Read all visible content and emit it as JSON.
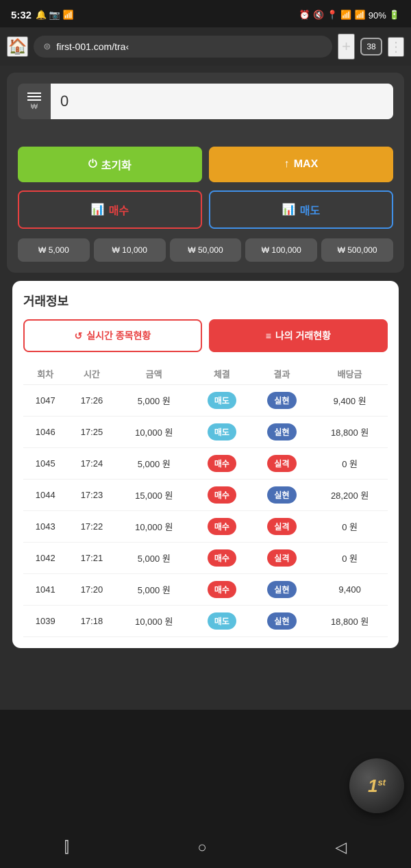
{
  "statusBar": {
    "time": "5:32",
    "battery": "90%",
    "batteryIcon": "🔋"
  },
  "browserBar": {
    "url": "first-001.com/tra‹",
    "tabCount": "38"
  },
  "trading": {
    "amountValue": "0",
    "amountPlaceholder": "0",
    "resetLabel": "초기화",
    "maxLabel": "MAX",
    "buyLabel": "매수",
    "sellLabel": "매도",
    "quickAmounts": [
      "₩ 5,000",
      "₩ 10,000",
      "₩ 50,000",
      "₩ 100,000",
      "₩ 500,000"
    ]
  },
  "tradingInfo": {
    "sectionTitle": "거래정보",
    "tabRealtime": "실시간 종목현황",
    "tabMyTrades": "나의 거래현황",
    "tableHeaders": [
      "회차",
      "시간",
      "금액",
      "체결",
      "결과",
      "배당금"
    ],
    "rows": [
      {
        "round": "1047",
        "time": "17:26",
        "amount": "5,000 원",
        "type": "매도",
        "typeClass": "sell",
        "result": "실현",
        "resultClass": "success",
        "dividend": "9,400 원"
      },
      {
        "round": "1046",
        "time": "17:25",
        "amount": "10,000 원",
        "type": "매도",
        "typeClass": "sell",
        "result": "실현",
        "resultClass": "success",
        "dividend": "18,800 원"
      },
      {
        "round": "1045",
        "time": "17:24",
        "amount": "5,000 원",
        "type": "매수",
        "typeClass": "buy",
        "result": "실격",
        "resultClass": "fail",
        "dividend": "0 원"
      },
      {
        "round": "1044",
        "time": "17:23",
        "amount": "15,000 원",
        "type": "매수",
        "typeClass": "buy",
        "result": "실현",
        "resultClass": "success",
        "dividend": "28,200 원"
      },
      {
        "round": "1043",
        "time": "17:22",
        "amount": "10,000 원",
        "type": "매수",
        "typeClass": "buy",
        "result": "실격",
        "resultClass": "fail",
        "dividend": "0 원"
      },
      {
        "round": "1042",
        "time": "17:21",
        "amount": "5,000 원",
        "type": "매수",
        "typeClass": "buy",
        "result": "실격",
        "resultClass": "fail",
        "dividend": "0 원"
      },
      {
        "round": "1041",
        "time": "17:20",
        "amount": "5,000 원",
        "type": "매수",
        "typeClass": "buy",
        "result": "실현",
        "resultClass": "success",
        "dividend": "9,400"
      },
      {
        "round": "1039",
        "time": "17:18",
        "amount": "10,000 원",
        "type": "매도",
        "typeClass": "sell",
        "result": "실현",
        "resultClass": "success",
        "dividend": "18,800 원"
      }
    ]
  },
  "logo": {
    "text": "1",
    "sup": "st"
  },
  "bottomNav": {
    "backBtn": "◁",
    "homeBtn": "○",
    "menuBtn": "▐▐▐"
  }
}
